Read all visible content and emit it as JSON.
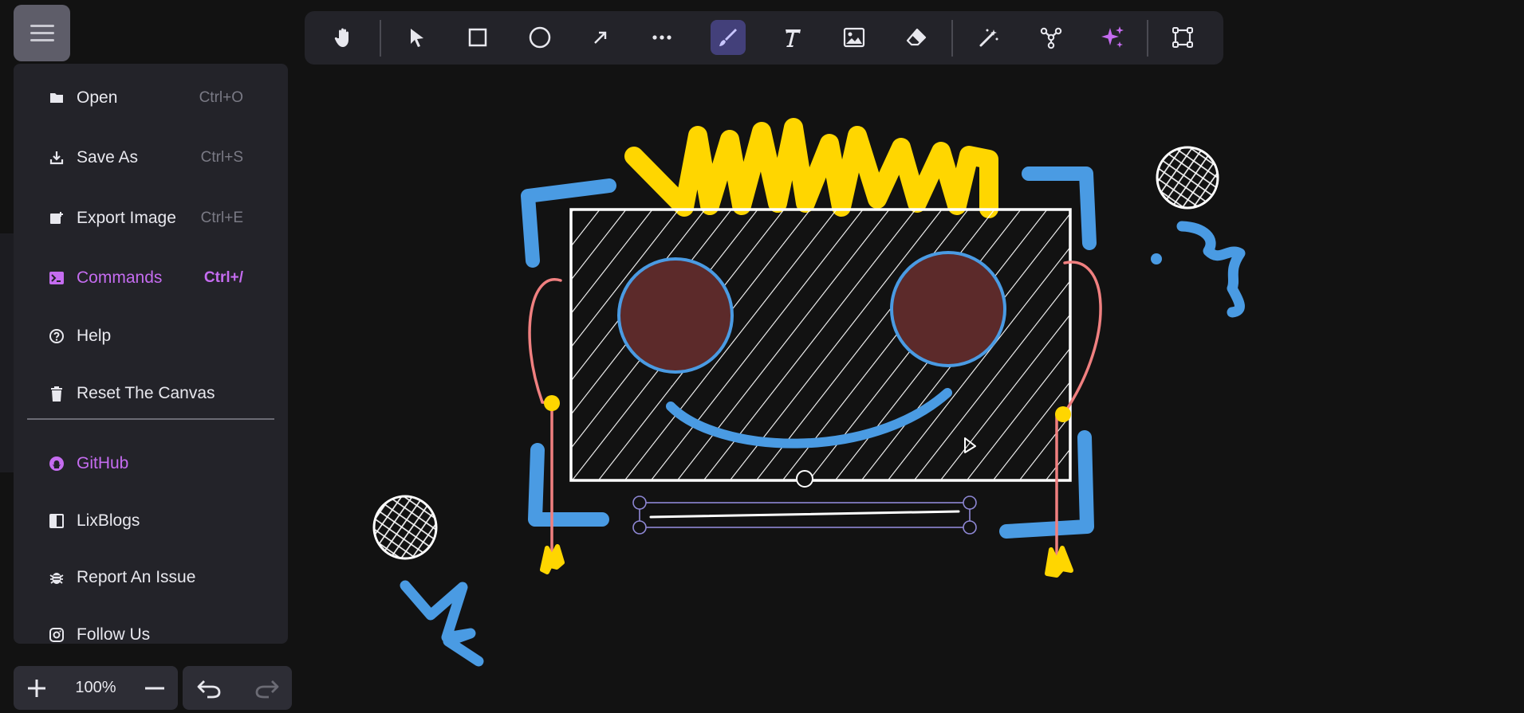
{
  "menu": {
    "items": [
      {
        "label": "Open",
        "shortcut": "Ctrl+O",
        "icon": "folder-open-icon"
      },
      {
        "label": "Save As",
        "shortcut": "Ctrl+S",
        "icon": "download-icon"
      },
      {
        "label": "Export Image",
        "shortcut": "Ctrl+E",
        "icon": "export-image-icon"
      },
      {
        "label": "Commands",
        "shortcut": "Ctrl+/",
        "icon": "terminal-icon"
      },
      {
        "label": "Help",
        "shortcut": "",
        "icon": "help-circle-icon"
      },
      {
        "label": "Reset The Canvas",
        "shortcut": "",
        "icon": "trash-icon"
      }
    ],
    "links": [
      {
        "label": "GitHub",
        "icon": "github-icon"
      },
      {
        "label": "LixBlogs",
        "icon": "book-icon"
      },
      {
        "label": "Report An Issue",
        "icon": "bug-icon"
      },
      {
        "label": "Follow Us",
        "icon": "instagram-icon"
      }
    ]
  },
  "toolbar": {
    "tools": [
      "hand-tool",
      "select-tool",
      "rectangle-tool",
      "circle-tool",
      "arrow-tool",
      "more-tool",
      "freehand-tool",
      "text-tool",
      "image-tool",
      "eraser-tool",
      "magic-wand-tool",
      "graph-tool",
      "ai-sparkle-tool",
      "frame-tool"
    ],
    "active_tool": "freehand-tool"
  },
  "zoom": {
    "level": "100%"
  },
  "colors": {
    "accent": "#c56cf0",
    "canvas_bg": "#121212",
    "panel_bg": "#232329",
    "active_tool_bg": "#43407a",
    "blue": "#4a9be3",
    "yellow": "#ffd600",
    "pink": "#f08080",
    "eye_fill": "#5c2a2a"
  }
}
